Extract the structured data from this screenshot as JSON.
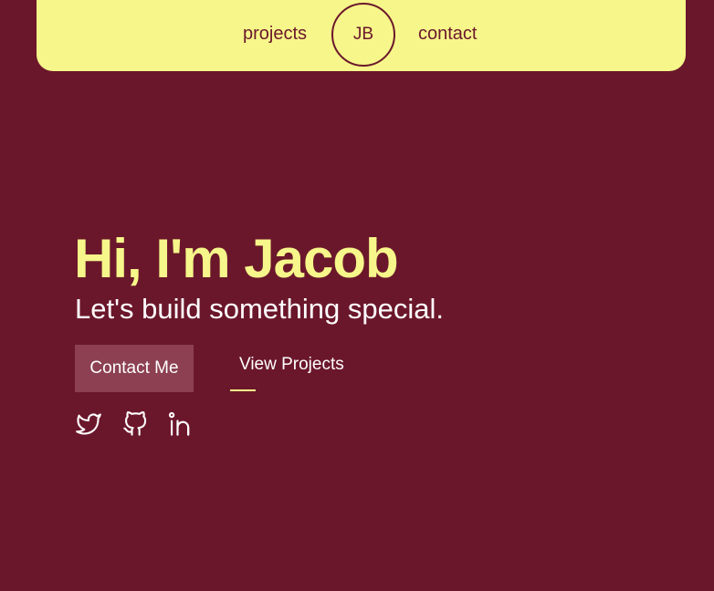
{
  "nav": {
    "projects_label": "projects",
    "logo_text": "JB",
    "contact_label": "contact"
  },
  "hero": {
    "title": "Hi, I'm Jacob",
    "subtitle": "Let's build something special.",
    "contact_button": "Contact Me",
    "projects_button": "View Projects"
  },
  "social": {
    "icons": [
      "twitter-icon",
      "github-icon",
      "linkedin-icon"
    ]
  },
  "colors": {
    "background": "#6b172b",
    "accent": "#f6f68a",
    "text": "#ffffff",
    "button": "#8c4052"
  }
}
